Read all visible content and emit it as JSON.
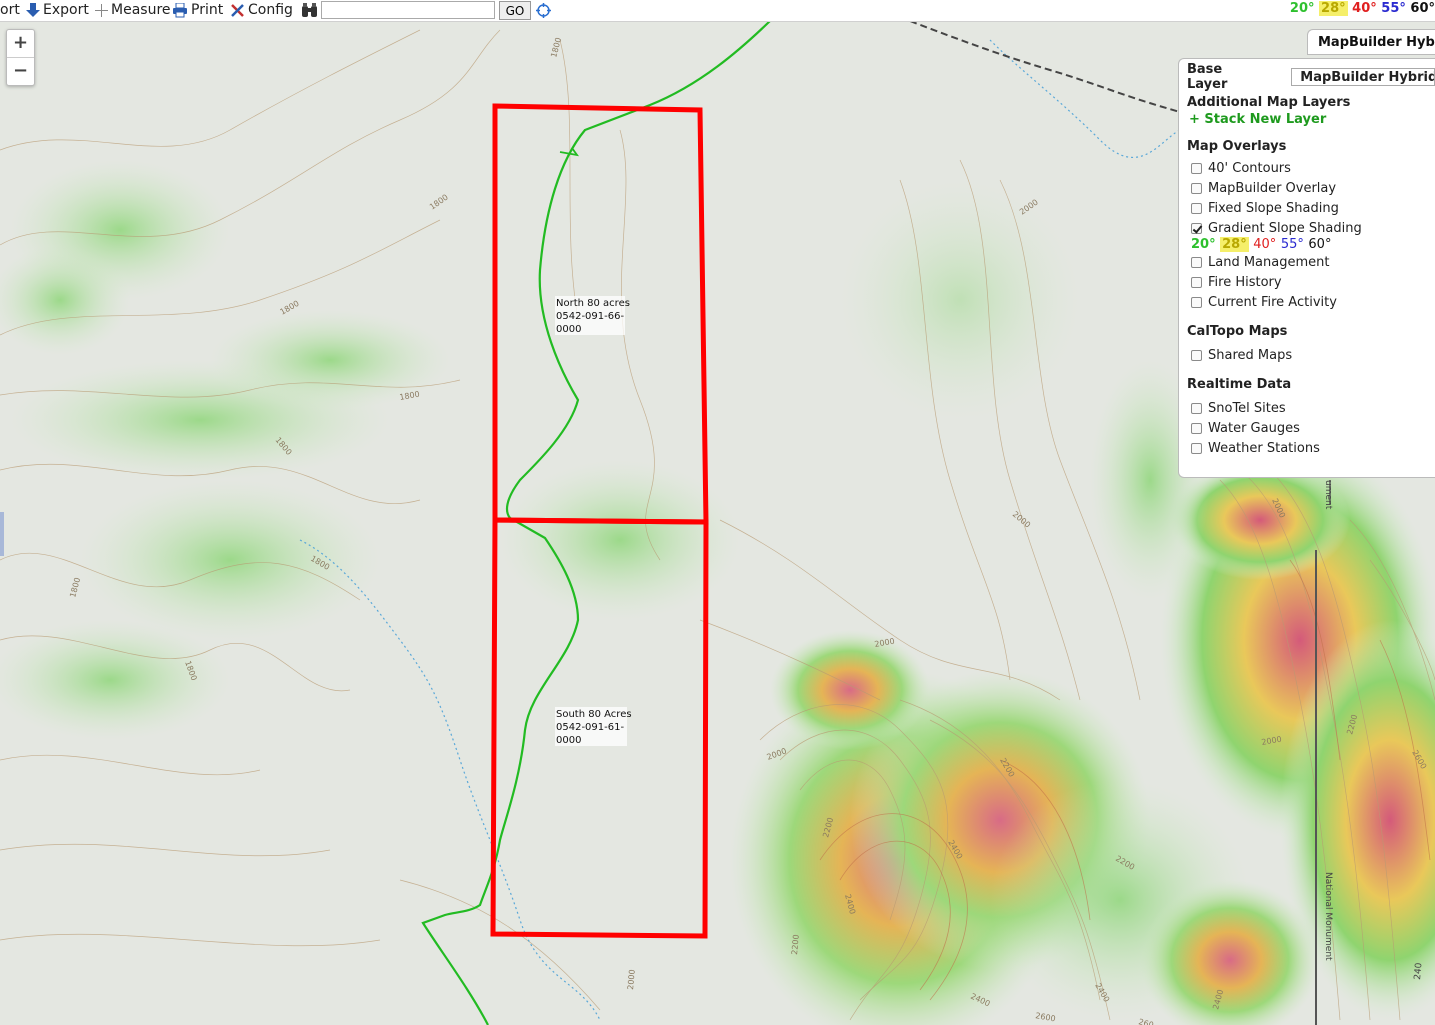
{
  "toolbar": {
    "import_label": "ort",
    "export_label": "Export",
    "measure_label": "Measure",
    "print_label": "Print",
    "config_label": "Config",
    "search_value": "",
    "go_label": "GO"
  },
  "slope_legend": {
    "v20": "20°",
    "v28": "28°",
    "v40": "40°",
    "v55": "55°",
    "v60": "60°"
  },
  "zoom": {
    "in": "+",
    "out": "−"
  },
  "layer_tab": {
    "label": "MapBuilder Hybrid"
  },
  "panel": {
    "base_layer_label": "Base Layer",
    "base_layer_value": "MapBuilder Hybrid",
    "additional_label": "Additional Map Layers",
    "stack_new_layer": "+ Stack New Layer",
    "overlays_label": "Map Overlays",
    "overlays": [
      {
        "label": "40' Contours",
        "checked": false
      },
      {
        "label": "MapBuilder Overlay",
        "checked": false
      },
      {
        "label": "Fixed Slope Shading",
        "checked": false
      },
      {
        "label": "Gradient Slope Shading",
        "checked": true
      },
      {
        "label": "Land Management",
        "checked": false
      },
      {
        "label": "Fire History",
        "checked": false
      },
      {
        "label": "Current Fire Activity",
        "checked": false
      }
    ],
    "caltopo_label": "CalTopo Maps",
    "shared_maps": "Shared Maps",
    "realtime_label": "Realtime Data",
    "realtime": [
      {
        "label": "SnoTel Sites",
        "checked": false
      },
      {
        "label": "Water Gauges",
        "checked": false
      },
      {
        "label": "Weather Stations",
        "checked": false
      }
    ]
  },
  "map": {
    "parcels": {
      "north": {
        "line1": "North 80 acres",
        "line2": "0542-091-66-",
        "line3": "0000"
      },
      "south": {
        "line1": "South 80 Acres",
        "line2": "0542-091-61-",
        "line3": "0000"
      }
    },
    "contour_labels": [
      "1800",
      "1800",
      "1800",
      "1800",
      "1800",
      "1800",
      "1800",
      "1800",
      "2000",
      "2000",
      "2000",
      "2000",
      "2000",
      "2200",
      "2200",
      "2200",
      "2200",
      "2400",
      "2400",
      "2400",
      "2400",
      "2600",
      "2000",
      "2000",
      "2200",
      "2400",
      "2600",
      "260"
    ],
    "boundary_labels": [
      "ument",
      "National Monument",
      "240"
    ],
    "colors": {
      "parcel": "#ff0000",
      "trail": "#22bb22",
      "stream": "#5aa8d8",
      "slope_low": "#7fd36a",
      "slope_mid": "#e8c24a",
      "slope_high": "#d45a7a"
    }
  }
}
